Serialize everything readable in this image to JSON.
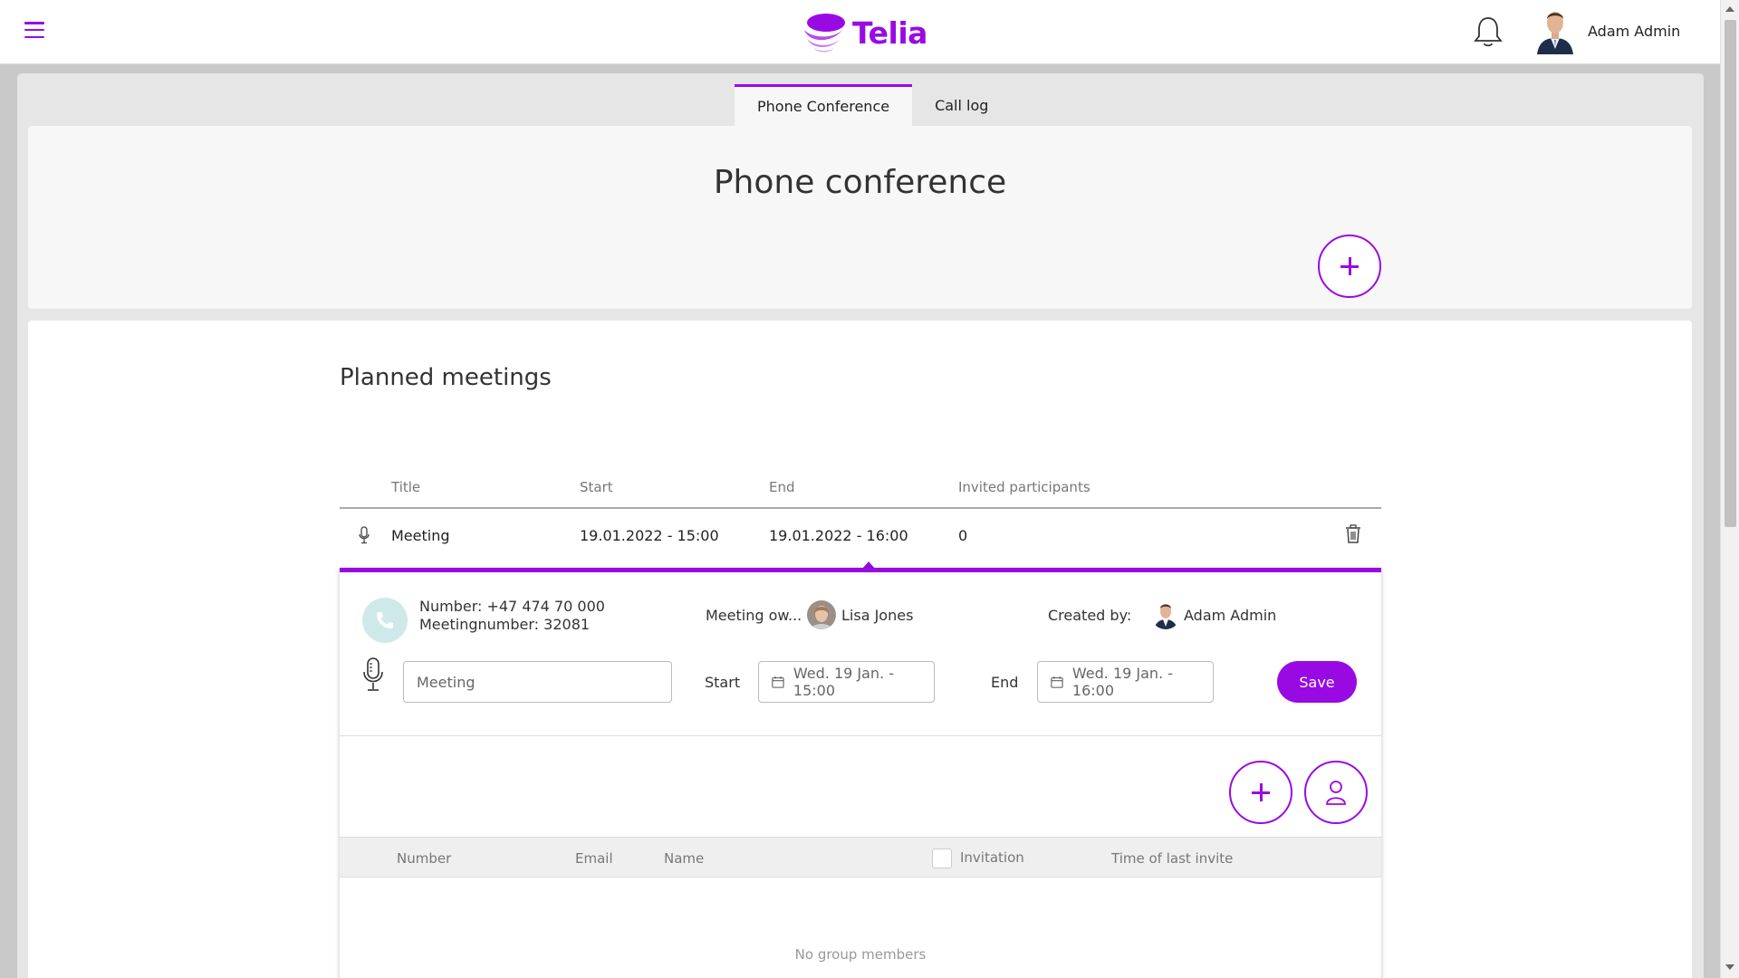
{
  "header": {
    "brand": "Telia",
    "user_name": "Adam Admin",
    "icons": {
      "menu": "hamburger-icon",
      "notifications": "bell-icon"
    }
  },
  "colors": {
    "accent": "#990ae3",
    "phone_bg": "#cfe9ea"
  },
  "tabs": [
    {
      "label": "Phone Conference",
      "active": true
    },
    {
      "label": "Call log",
      "active": false
    }
  ],
  "page": {
    "title": "Phone conference"
  },
  "planned": {
    "title": "Planned meetings",
    "columns": [
      "Title",
      "Start",
      "End",
      "Invited participants"
    ],
    "rows": [
      {
        "title": "Meeting",
        "start": "19.01.2022 - 15:00",
        "end": "19.01.2022 - 16:00",
        "participants": "0"
      }
    ]
  },
  "details": {
    "number_line": "Number: +47 474 70 000",
    "meeting_number_line": "Meetingnumber: 32081",
    "owner_label": "Meeting ow...",
    "owner_name": "Lisa Jones",
    "created_label": "Created by:",
    "creator_name": "Adam Admin",
    "title_value": "Meeting",
    "start_label": "Start",
    "start_value": "Wed. 19 Jan. - 15:00",
    "end_label": "End",
    "end_value": "Wed. 19 Jan. - 16:00",
    "save_label": "Save"
  },
  "members": {
    "columns": {
      "number": "Number",
      "email": "Email",
      "name": "Name",
      "invitation": "Invitation",
      "time_last_invite": "Time of last invite"
    },
    "empty_text": "No group members"
  }
}
